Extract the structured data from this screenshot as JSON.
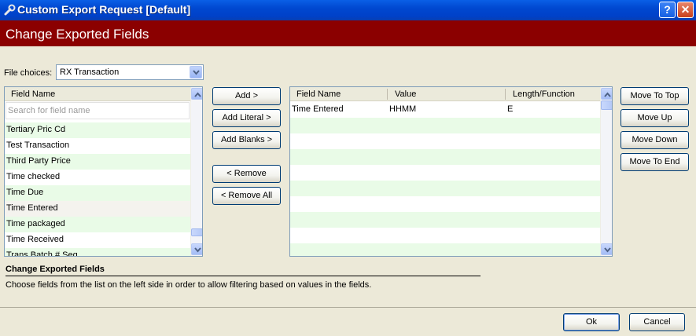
{
  "window": {
    "title": "Custom Export Request [Default]",
    "help_glyph": "?",
    "close_glyph": "✕"
  },
  "header": {
    "title": "Change Exported Fields"
  },
  "file_choices": {
    "label": "File choices:",
    "value": "RX Transaction"
  },
  "left_list": {
    "column": "Field Name",
    "search_placeholder": "Search for field name",
    "items": [
      "Tertiary Pric Cd",
      "Test Transaction",
      "Third Party Price",
      "Time checked",
      "Time Due",
      "Time Entered",
      "Time packaged",
      "Time Received",
      "Trans Batch # Seq"
    ],
    "selected_index": 5
  },
  "middle_buttons": {
    "add": "Add >",
    "add_literal": "Add Literal >",
    "add_blanks": "Add Blanks >",
    "remove": "< Remove",
    "remove_all": "< Remove All"
  },
  "right_table": {
    "columns": [
      "Field Name",
      "Value",
      "Length/Function"
    ],
    "rows": [
      {
        "field": "Time Entered",
        "value": "HHMM",
        "length": "E"
      }
    ]
  },
  "order_buttons": {
    "top": "Move To Top",
    "up": "Move Up",
    "down": "Move Down",
    "end": "Move To End"
  },
  "description": {
    "title": "Change Exported Fields",
    "text": "Choose fields from the list on the left side in order to allow filtering based on values in the fields."
  },
  "footer": {
    "ok": "Ok",
    "cancel": "Cancel"
  },
  "colors": {
    "title_bar": "#0048D0",
    "header_bg": "#8B0000",
    "row_alt": "#E9FBE7",
    "dialog_bg": "#ECE9D8"
  }
}
